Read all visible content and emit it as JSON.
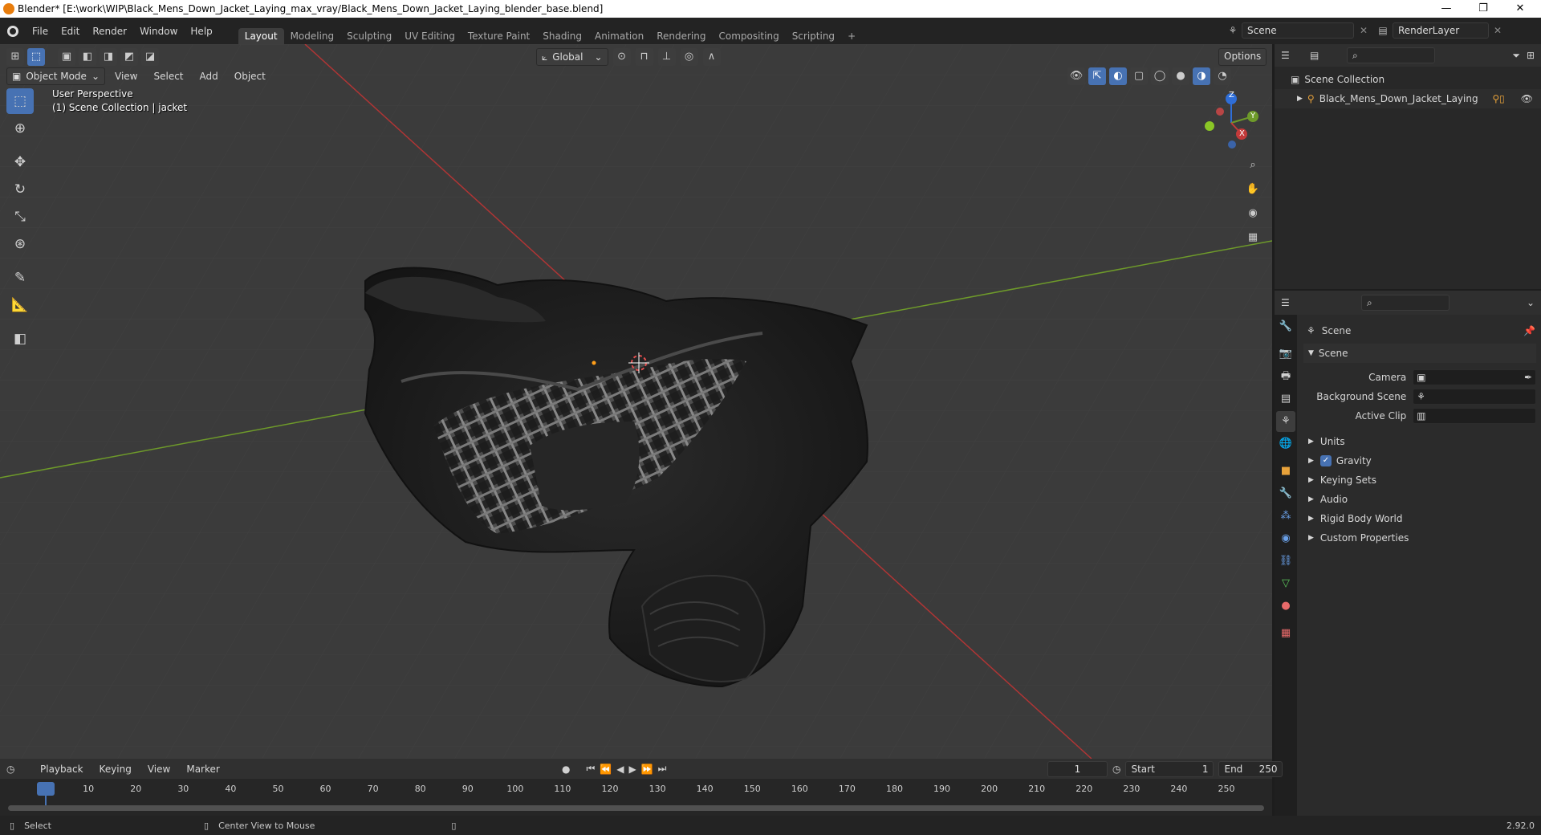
{
  "titlebar": {
    "title": "Blender* [E:\\work\\WIP\\Black_Mens_Down_Jacket_Laying_max_vray/Black_Mens_Down_Jacket_Laying_blender_base.blend]",
    "minimize": "—",
    "maximize": "❐",
    "close": "✕"
  },
  "menu": {
    "items": [
      "File",
      "Edit",
      "Render",
      "Window",
      "Help"
    ]
  },
  "workspaces": [
    "Layout",
    "Modeling",
    "Sculpting",
    "UV Editing",
    "Texture Paint",
    "Shading",
    "Animation",
    "Rendering",
    "Compositing",
    "Scripting"
  ],
  "workspace_add": "+",
  "scene_field": "Scene",
  "view_layer_field": "RenderLayer",
  "viewport": {
    "mode": "Object Mode",
    "menus": [
      "View",
      "Select",
      "Add",
      "Object"
    ],
    "transform_orientation": "Global",
    "options": "Options",
    "overlay_line1": "User Perspective",
    "overlay_line2": "(1) Scene Collection | jacket",
    "gizmo": {
      "x": "X",
      "y": "Y",
      "z": "Z"
    }
  },
  "outliner": {
    "collection": "Scene Collection",
    "object": "Black_Mens_Down_Jacket_Laying"
  },
  "properties": {
    "header": "Scene",
    "panel": "Scene",
    "camera_label": "Camera",
    "bg_scene_label": "Background Scene",
    "active_clip_label": "Active Clip",
    "sections": [
      "Units",
      "Gravity",
      "Keying Sets",
      "Audio",
      "Rigid Body World",
      "Custom Properties"
    ],
    "gravity_checked": true
  },
  "timeline": {
    "menus": [
      "Playback",
      "Keying",
      "View",
      "Marker"
    ],
    "current_frame": "1",
    "start_label": "Start",
    "start_value": "1",
    "end_label": "End",
    "end_value": "250",
    "ticks": [
      "1",
      "10",
      "20",
      "30",
      "40",
      "50",
      "60",
      "70",
      "80",
      "90",
      "100",
      "110",
      "120",
      "130",
      "140",
      "150",
      "160",
      "170",
      "180",
      "190",
      "200",
      "210",
      "220",
      "230",
      "240",
      "250"
    ]
  },
  "statusbar": {
    "select": "Select",
    "center_view": "Center View to Mouse",
    "version": "2.92.0"
  },
  "colors": {
    "accent": "#4772b3",
    "x_axis": "#c33a3a",
    "y_axis": "#6e9a2a",
    "z_axis": "#2f6ed8"
  }
}
